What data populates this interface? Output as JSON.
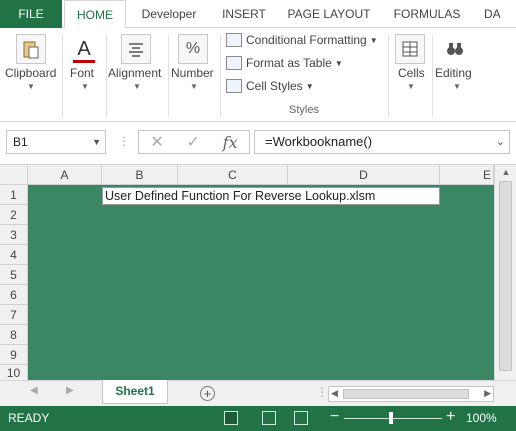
{
  "tabs": [
    {
      "label": "FILE"
    },
    {
      "label": "HOME"
    },
    {
      "label": "Developer"
    },
    {
      "label": "INSERT"
    },
    {
      "label": "PAGE LAYOUT"
    },
    {
      "label": "FORMULAS"
    },
    {
      "label": "DA"
    }
  ],
  "ribbon": {
    "clipboard": "Clipboard",
    "font": "Font",
    "alignment": "Alignment",
    "number": "Number",
    "conditional_formatting": "Conditional Formatting",
    "format_as_table": "Format as Table",
    "cell_styles": "Cell Styles",
    "styles_group": "Styles",
    "cells": "Cells",
    "editing": "Editing",
    "font_icon": "A",
    "number_icon": "%"
  },
  "formula_bar": {
    "name_box": "B1",
    "formula": "=Workbookname()",
    "fx": "fx",
    "cancel": "✕",
    "enter": "✓"
  },
  "grid": {
    "columns": [
      "A",
      "B",
      "C",
      "D",
      "E"
    ],
    "rows": [
      "1",
      "2",
      "3",
      "4",
      "5",
      "6",
      "7",
      "8",
      "9",
      "10"
    ],
    "cell_b1": "User Defined Function For Reverse Lookup.xlsm",
    "fill_color": "#3b8764"
  },
  "sheet_tabs": {
    "active": "Sheet1",
    "add": "+"
  },
  "status": {
    "ready": "READY",
    "zoom": "100%",
    "minus": "−",
    "plus": "+"
  },
  "colors": {
    "accent": "#217346"
  }
}
